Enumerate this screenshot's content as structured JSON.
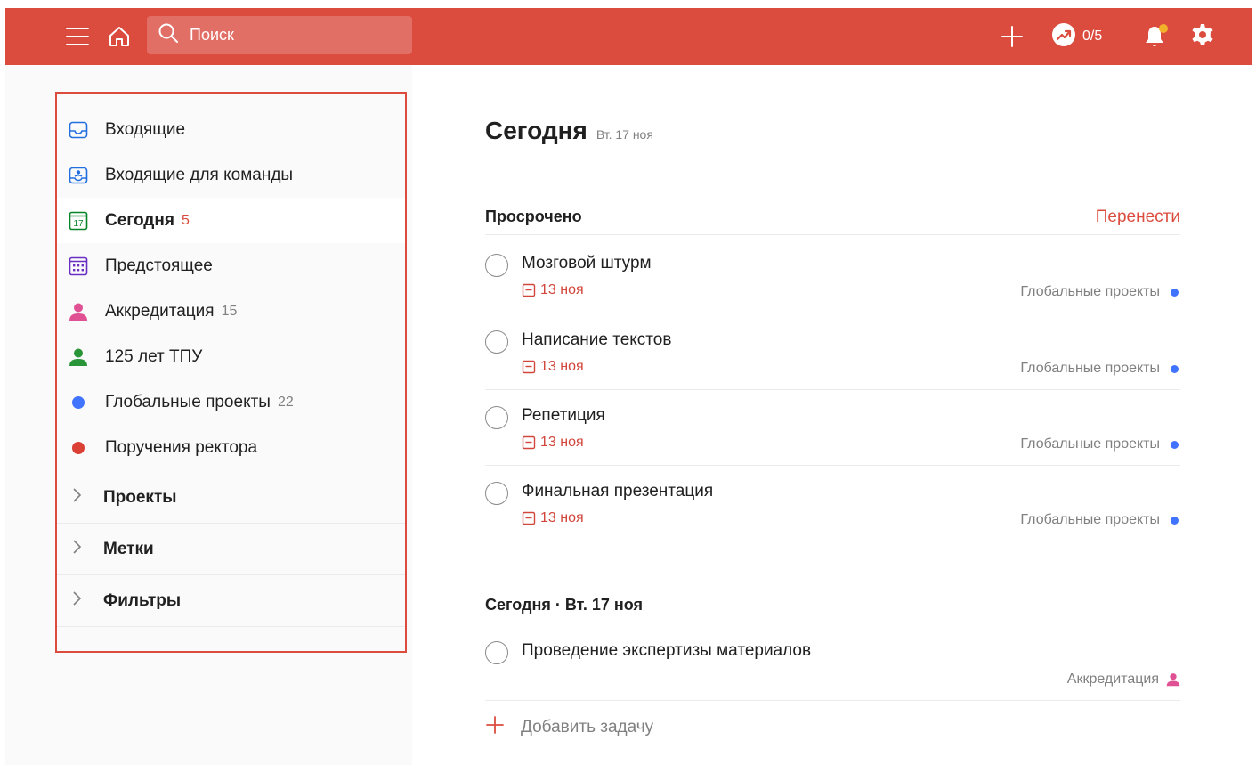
{
  "topbar": {
    "menu_icon": "menu-icon",
    "home_icon": "home-icon",
    "search_placeholder": "Поиск",
    "add_icon": "plus-icon",
    "karma_text": "0/5",
    "notification_icon": "bell-icon",
    "settings_icon": "gear-icon",
    "color": "#db4c3f"
  },
  "sidebar": {
    "items": [
      {
        "label": "Входящие",
        "count": "",
        "icon": "inbox-icon",
        "active": false
      },
      {
        "label": "Входящие для команды",
        "count": "",
        "icon": "team-inbox-icon",
        "active": false
      },
      {
        "label": "Сегодня",
        "count": "5",
        "icon": "calendar-today-icon",
        "active": true
      },
      {
        "label": "Предстоящее",
        "count": "",
        "icon": "calendar-upcoming-icon",
        "active": false
      },
      {
        "label": "Аккредитация",
        "count": "15",
        "icon": "person-icon",
        "color": "#e05194",
        "active": false
      },
      {
        "label": "125 лет ТПУ",
        "count": "",
        "icon": "person-icon",
        "color": "#299438",
        "active": false
      },
      {
        "label": "Глобальные проекты",
        "count": "22",
        "icon": "dot-icon",
        "color": "#4073ff",
        "active": false
      },
      {
        "label": "Поручения ректора",
        "count": "",
        "icon": "dot-icon",
        "color": "#db4035",
        "active": false
      }
    ],
    "sections": [
      {
        "label": "Проекты"
      },
      {
        "label": "Метки"
      },
      {
        "label": "Фильтры"
      }
    ]
  },
  "main": {
    "title": "Сегодня",
    "date": "Вт. 17 ноя",
    "overdue": {
      "title": "Просрочено",
      "action": "Перенести",
      "tasks": [
        {
          "title": "Мозговой штурм",
          "due": "13 ноя",
          "project": "Глобальные проекты"
        },
        {
          "title": "Написание текстов",
          "due": "13 ноя",
          "project": "Глобальные проекты"
        },
        {
          "title": "Репетиция",
          "due": "13 ноя",
          "project": "Глобальные проекты"
        },
        {
          "title": "Финальная презентация",
          "due": "13 ноя",
          "project": "Глобальные проекты"
        }
      ]
    },
    "today": {
      "title": "Сегодня · Вт. 17 ноя",
      "tasks": [
        {
          "title": "Проведение экспертизы материалов",
          "project": "Аккредитация"
        }
      ]
    },
    "add_task_label": "Добавить задачу"
  }
}
